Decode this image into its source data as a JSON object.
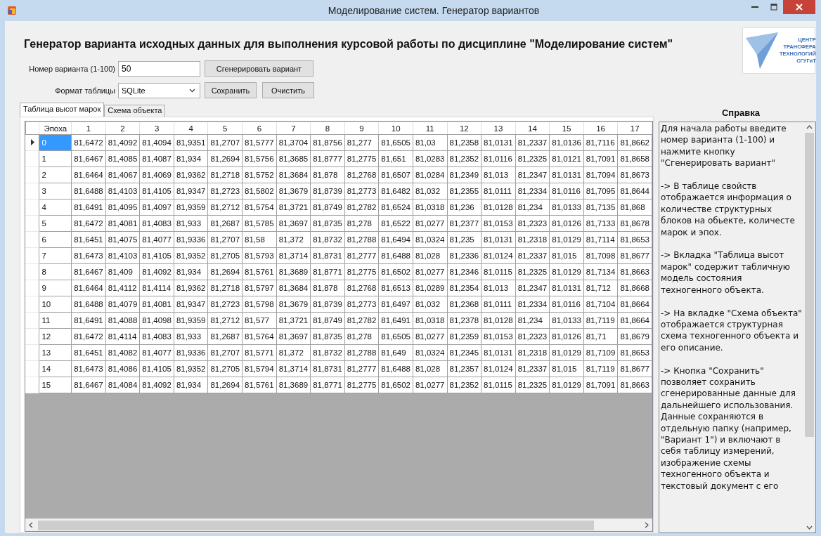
{
  "window": {
    "title": "Моделирование систем. Генератор вариантов"
  },
  "heading": "Генератор варианта исходных данных для выполнения курсовой работы по дисциплине \"Моделирование систем\"",
  "logo": {
    "lines": [
      "ЦЕНТР",
      "ТРАНСФЕРА",
      "ТЕХНОЛОГИЙ",
      "СГУГиТ"
    ]
  },
  "variant_field": {
    "label": "Номер варианта (1-100)",
    "value": "50"
  },
  "generate_button": "Сгенерировать вариант",
  "format_field": {
    "label": "Формат таблицы",
    "value": "SQLite"
  },
  "buttons": [
    "Сохранить",
    "Очистить"
  ],
  "tabs": [
    {
      "label": "Таблица высот марок",
      "selected": true
    },
    {
      "label": "Схема объекта",
      "selected": false
    }
  ],
  "table": {
    "columns": [
      "Эпоха",
      "1",
      "2",
      "3",
      "4",
      "5",
      "6",
      "7",
      "8",
      "9",
      "10",
      "11",
      "12",
      "13",
      "14",
      "15",
      "16",
      "17"
    ],
    "rows": [
      {
        "selected": true,
        "cells": [
          "0",
          "81,6472",
          "81,4092",
          "81,4094",
          "81,9351",
          "81,2707",
          "81,5777",
          "81,3704",
          "81,8756",
          "81,277",
          "81,6505",
          "81,03",
          "81,2358",
          "81,0131",
          "81,2337",
          "81,0136",
          "81,7116",
          "81,8662"
        ]
      },
      {
        "selected": false,
        "cells": [
          "1",
          "81,6467",
          "81,4085",
          "81,4087",
          "81,934",
          "81,2694",
          "81,5756",
          "81,3685",
          "81,8777",
          "81,2775",
          "81,651",
          "81,0283",
          "81,2352",
          "81,0116",
          "81,2325",
          "81,0121",
          "81,7091",
          "81,8658"
        ]
      },
      {
        "selected": false,
        "cells": [
          "2",
          "81,6464",
          "81,4067",
          "81,4069",
          "81,9362",
          "81,2718",
          "81,5752",
          "81,3684",
          "81,878",
          "81,2768",
          "81,6507",
          "81,0284",
          "81,2349",
          "81,013",
          "81,2347",
          "81,0131",
          "81,7094",
          "81,8673"
        ]
      },
      {
        "selected": false,
        "cells": [
          "3",
          "81,6488",
          "81,4103",
          "81,4105",
          "81,9347",
          "81,2723",
          "81,5802",
          "81,3679",
          "81,8739",
          "81,2773",
          "81,6482",
          "81,032",
          "81,2355",
          "81,0111",
          "81,2334",
          "81,0116",
          "81,7095",
          "81,8644"
        ]
      },
      {
        "selected": false,
        "cells": [
          "4",
          "81,6491",
          "81,4095",
          "81,4097",
          "81,9359",
          "81,2712",
          "81,5754",
          "81,3721",
          "81,8749",
          "81,2782",
          "81,6524",
          "81,0318",
          "81,236",
          "81,0128",
          "81,234",
          "81,0133",
          "81,7135",
          "81,868"
        ]
      },
      {
        "selected": false,
        "cells": [
          "5",
          "81,6472",
          "81,4081",
          "81,4083",
          "81,933",
          "81,2687",
          "81,5785",
          "81,3697",
          "81,8735",
          "81,278",
          "81,6522",
          "81,0277",
          "81,2377",
          "81,0153",
          "81,2323",
          "81,0126",
          "81,7133",
          "81,8678"
        ]
      },
      {
        "selected": false,
        "cells": [
          "6",
          "81,6451",
          "81,4075",
          "81,4077",
          "81,9336",
          "81,2707",
          "81,58",
          "81,372",
          "81,8732",
          "81,2788",
          "81,6494",
          "81,0324",
          "81,235",
          "81,0131",
          "81,2318",
          "81,0129",
          "81,7114",
          "81,8653"
        ]
      },
      {
        "selected": false,
        "cells": [
          "7",
          "81,6473",
          "81,4103",
          "81,4105",
          "81,9352",
          "81,2705",
          "81,5793",
          "81,3714",
          "81,8731",
          "81,2777",
          "81,6488",
          "81,028",
          "81,2336",
          "81,0124",
          "81,2337",
          "81,015",
          "81,7098",
          "81,8677"
        ]
      },
      {
        "selected": false,
        "cells": [
          "8",
          "81,6467",
          "81,409",
          "81,4092",
          "81,934",
          "81,2694",
          "81,5761",
          "81,3689",
          "81,8771",
          "81,2775",
          "81,6502",
          "81,0277",
          "81,2346",
          "81,0115",
          "81,2325",
          "81,0129",
          "81,7134",
          "81,8663"
        ]
      },
      {
        "selected": false,
        "cells": [
          "9",
          "81,6464",
          "81,4112",
          "81,4114",
          "81,9362",
          "81,2718",
          "81,5797",
          "81,3684",
          "81,878",
          "81,2768",
          "81,6513",
          "81,0289",
          "81,2354",
          "81,013",
          "81,2347",
          "81,0131",
          "81,712",
          "81,8668"
        ]
      },
      {
        "selected": false,
        "cells": [
          "10",
          "81,6488",
          "81,4079",
          "81,4081",
          "81,9347",
          "81,2723",
          "81,5798",
          "81,3679",
          "81,8739",
          "81,2773",
          "81,6497",
          "81,032",
          "81,2368",
          "81,0111",
          "81,2334",
          "81,0116",
          "81,7104",
          "81,8664"
        ]
      },
      {
        "selected": false,
        "cells": [
          "11",
          "81,6491",
          "81,4088",
          "81,4098",
          "81,9359",
          "81,2712",
          "81,577",
          "81,3721",
          "81,8749",
          "81,2782",
          "81,6491",
          "81,0318",
          "81,2378",
          "81,0128",
          "81,234",
          "81,0133",
          "81,7119",
          "81,8664"
        ]
      },
      {
        "selected": false,
        "cells": [
          "12",
          "81,6472",
          "81,4114",
          "81,4083",
          "81,933",
          "81,2687",
          "81,5764",
          "81,3697",
          "81,8735",
          "81,278",
          "81,6505",
          "81,0277",
          "81,2359",
          "81,0153",
          "81,2323",
          "81,0126",
          "81,71",
          "81,8679"
        ]
      },
      {
        "selected": false,
        "cells": [
          "13",
          "81,6451",
          "81,4082",
          "81,4077",
          "81,9336",
          "81,2707",
          "81,5771",
          "81,372",
          "81,8732",
          "81,2788",
          "81,649",
          "81,0324",
          "81,2345",
          "81,0131",
          "81,2318",
          "81,0129",
          "81,7109",
          "81,8653"
        ]
      },
      {
        "selected": false,
        "cells": [
          "14",
          "81,6473",
          "81,4086",
          "81,4105",
          "81,9352",
          "81,2705",
          "81,5794",
          "81,3714",
          "81,8731",
          "81,2777",
          "81,6488",
          "81,028",
          "81,2357",
          "81,0124",
          "81,2337",
          "81,015",
          "81,7119",
          "81,8677"
        ]
      },
      {
        "selected": false,
        "cells": [
          "15",
          "81,6467",
          "81,4084",
          "81,4092",
          "81,934",
          "81,2694",
          "81,5761",
          "81,3689",
          "81,8771",
          "81,2775",
          "81,6502",
          "81,0277",
          "81,2352",
          "81,0115",
          "81,2325",
          "81,0129",
          "81,7091",
          "81,8663"
        ]
      }
    ]
  },
  "help": {
    "title": "Справка",
    "text": "Для начала работы введите номер варианта (1-100) и нажмите кнопку \"Сгенерировать вариант\"\n\n-> В таблице свойств отображается информация о количестве структурных блоков на обьекте, количесте марок и эпох.\n\n-> Вкладка \"Таблица высот марок\" содержит табличную модель состояния техногенного объекта.\n\n-> На вкладке \"Схема объекта\" отображается структурная схема техногенного объекта и его описание.\n\n-> Кнопка \"Сохранить\" позволяет сохранить сгенерированные данные для дальнейшего использования.\nДанные сохраняются в отдельную папку (например, \"Вариант 1\") и включают в себя таблицу измерений, изображение схемы техногенного объекта и текстовый документ с его"
  }
}
